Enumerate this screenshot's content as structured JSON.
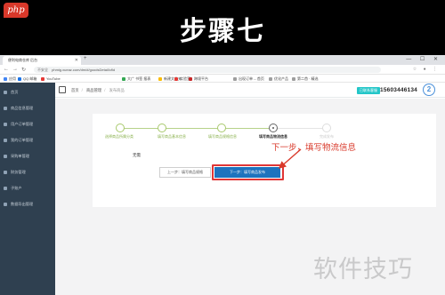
{
  "banner": {
    "logo_text": "php",
    "title": "步骤七"
  },
  "browser": {
    "tab_title": "便利电商仓库 后台",
    "new_tab": "+",
    "url_security": "不安全",
    "url": "phmig.xueaz.com/dm/#/goodsDetail/cfld",
    "address_right_icons": "☆ ● ⋮",
    "window_controls": "— ☐ ✕",
    "bookmarks": [
      {
        "label": "应用",
        "color": "#4285f4"
      },
      {
        "label": "QQ 邮箱",
        "color": "#1a73e8"
      },
      {
        "label": "YouTube",
        "color": "#e53935"
      },
      {
        "label": "大广 书签 报表",
        "color": "#34a853"
      },
      {
        "label": "新建文件夹",
        "color": "#fbbc05"
      },
      {
        "label": "实验室",
        "color": "#e53935"
      },
      {
        "label": "跨境平台",
        "color": "#c62828"
      },
      {
        "label": "出现订单 -- 首页",
        "color": "#9e9e9e"
      },
      {
        "label": "优化产品",
        "color": "#9e9e9e"
      },
      {
        "label": "第二首 · 精选",
        "color": "#9e9e9e"
      }
    ]
  },
  "sidebar": {
    "items": [
      {
        "label": "首页"
      },
      {
        "label": "商品信息管理"
      },
      {
        "label": "用户订单管理"
      },
      {
        "label": "我的订单管理"
      },
      {
        "label": "采购单管理"
      },
      {
        "label": "财务管理"
      },
      {
        "label": "子账户"
      },
      {
        "label": "数据导出管理"
      }
    ]
  },
  "topbar": {
    "breadcrumb": [
      "首页",
      "商品管理",
      "发布商品"
    ],
    "badge": "已联系客服",
    "phone": "15603446134",
    "circle": "2"
  },
  "steps": [
    {
      "label": "选择商品所属分类",
      "state": "done"
    },
    {
      "label": "填写商品基本信息",
      "state": "done"
    },
    {
      "label": "填写商品规格信息",
      "state": "done"
    },
    {
      "label": "填写商品物流信息",
      "state": "current"
    },
    {
      "label": "完成发布",
      "state": "future"
    }
  ],
  "note": "无需",
  "buttons": {
    "prev": "上一步：填写商品规格",
    "next": "下一步：填写商品发布"
  },
  "annotation": "下一步，填写物流信息",
  "watermark": "软件技巧",
  "colors": {
    "sidebar": "#2f4050",
    "accent_blue": "#1e73be",
    "highlight_red": "#e03636",
    "step_green": "#a8c96c"
  }
}
